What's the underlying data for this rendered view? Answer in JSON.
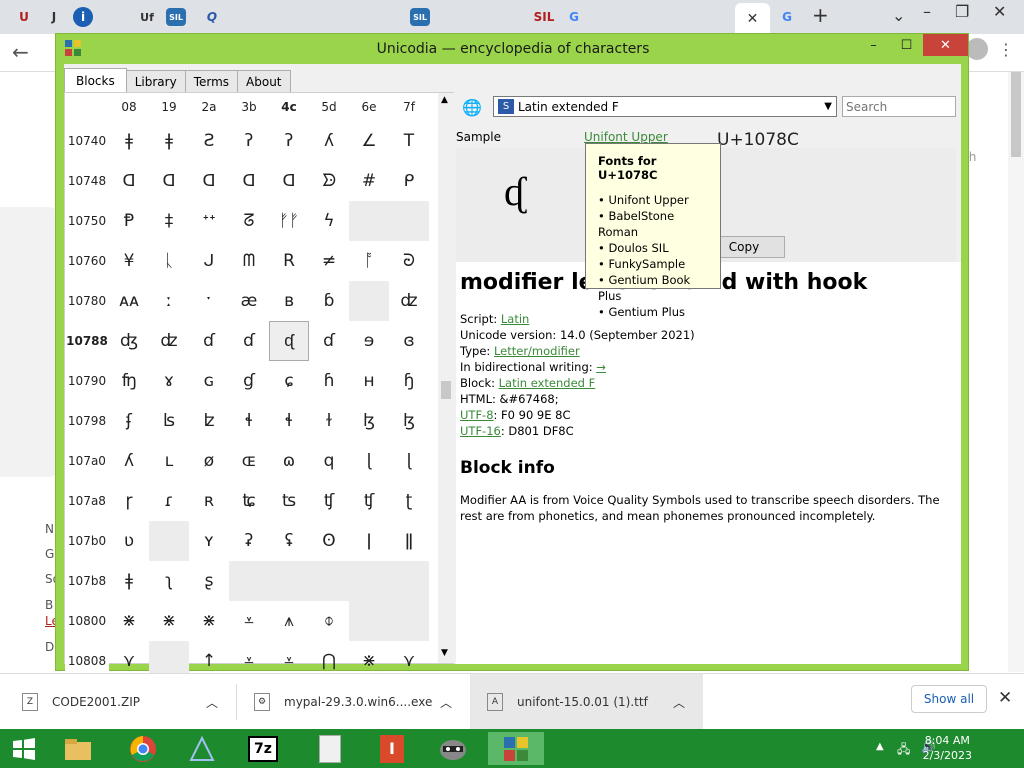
{
  "browser": {
    "tab_icons": [
      "U",
      "J",
      "i",
      "",
      "Uf",
      "SIL",
      "Q",
      "",
      "",
      "",
      "SIL",
      "",
      "",
      "SIL",
      "",
      "",
      "",
      "",
      "G",
      "",
      "",
      "",
      "",
      "",
      "G"
    ],
    "new_tab": "+",
    "tab_close": "✕",
    "bg_texts": [
      "N",
      "G",
      "So",
      "B",
      "Le",
      "D",
      "th"
    ]
  },
  "app": {
    "title": "Unicodia — encyclopedia of characters",
    "tabs": [
      "Blocks",
      "Library",
      "Terms",
      "About"
    ],
    "grid": {
      "col_headers": [
        "08",
        "19",
        "2a",
        "3b",
        "4c",
        "5d",
        "6e",
        "7f"
      ],
      "rows": [
        {
          "label": "10740",
          "cells": [
            "ǂ",
            "ǂ",
            "Ƨ",
            "ʔ",
            "ʔ",
            "ʎ",
            "∠",
            "T"
          ]
        },
        {
          "label": "10748",
          "cells": [
            "ᗡ",
            "ᗡ",
            "ᗡ",
            "ᗡ",
            "ᗡ",
            "ᗦ",
            "#",
            "ᑭ"
          ]
        },
        {
          "label": "10750",
          "cells": [
            "Ᵽ",
            "‡",
            "ᐩᐩ",
            "ᘔ",
            "ᚠᚠ",
            "ϟ",
            "",
            ""
          ]
        },
        {
          "label": "10760",
          "cells": [
            "¥",
            "ᚳ",
            "ᒍ",
            "ᗰ",
            "R",
            "≠",
            "ᚩ",
            "ᘒ"
          ]
        },
        {
          "label": "10780",
          "cells": [
            "ᴀᴀ",
            "ː",
            "ˑ",
            "æ",
            "ʙ",
            "ɓ",
            "",
            "ʣ"
          ]
        },
        {
          "label": "10788",
          "cells": [
            "ʤ",
            "ʣ",
            "ɗ",
            "ɗ",
            "ᶑ",
            "ɗ",
            "ɘ",
            "ɞ"
          ]
        },
        {
          "label": "10790",
          "cells": [
            "ʩ",
            "ɤ",
            "ɢ",
            "ɠ",
            "ɕ",
            "ɦ",
            "ʜ",
            "ɧ"
          ]
        },
        {
          "label": "10798",
          "cells": [
            "ʄ",
            "ʪ",
            "ʫ",
            "ɬ",
            "ɬ",
            "ɫ",
            "ɮ",
            "ɮ"
          ]
        },
        {
          "label": "107a0",
          "cells": [
            "ʎ",
            "ʟ",
            "ø",
            "ɶ",
            "ɷ",
            "q",
            "ɭ",
            "ɭ"
          ]
        },
        {
          "label": "107a8",
          "cells": [
            "ɼ",
            "ɾ",
            "ʀ",
            "ʨ",
            "ʦ",
            "ʧ",
            "ʧ",
            "ʈ"
          ]
        },
        {
          "label": "107b0",
          "cells": [
            "ʋ",
            "",
            "ʏ",
            "ʡ",
            "ʢ",
            "ʘ",
            "ǀ",
            "ǁ"
          ]
        },
        {
          "label": "107b8",
          "cells": [
            "ǂ",
            "ʅ",
            "ʂ",
            "",
            "",
            "",
            "",
            ""
          ]
        },
        {
          "label": "10800",
          "cells": [
            "⋇",
            "⋇",
            "⋇",
            "⩡",
            "⩚",
            "⌽",
            "",
            ""
          ]
        },
        {
          "label": "10808",
          "cells": [
            "⋎",
            "",
            "↑",
            "⩡",
            "⩡",
            "⋂",
            "⋇",
            "⋎"
          ]
        }
      ]
    },
    "block_select": "Latin extended F",
    "search_placeholder": "Search",
    "sample_label": "Sample",
    "font_link": "Unifont Upper",
    "codepoint": "U+1078C",
    "glyph": "ᶑ",
    "copy": "Copy",
    "char_name": "modifier letter small d with hook",
    "props": {
      "script_label": "Script: ",
      "script": "Latin",
      "version": "Unicode version: 14.0 (September 2021)",
      "type_label": "Type: ",
      "type": "Letter/modifier",
      "bidi_label": "In bidirectional writing: ",
      "bidi": "→",
      "block_label": "Block: ",
      "block": "Latin extended F",
      "html": "HTML: &#67468;",
      "utf8_label": "UTF-8",
      "utf8": ": F0 90 9E 8C",
      "utf16_label": "UTF-16",
      "utf16": ": D801 DF8C"
    },
    "block_info_heading": "Block info",
    "block_info": "Modifier AA is from Voice Quality Symbols used to transcribe speech disorders. The rest are from phonetics, and mean phonemes pronounced incompletely.",
    "tooltip": {
      "title": "Fonts for U+1078C",
      "items": [
        "• Unifont Upper",
        "• BabelStone Roman",
        "• Doulos SIL",
        "• FunkySample",
        "• Gentium Book Plus",
        "• Gentium Plus"
      ]
    }
  },
  "downloads": {
    "items": [
      "CODE2001.ZIP",
      "mypal-29.3.0.win6....exe",
      "unifont-15.0.01 (1).ttf"
    ],
    "show_all": "Show all"
  },
  "taskbar": {
    "time": "8:04 AM",
    "date": "2/3/2023",
    "icons": [
      "windows-start",
      "file-explorer",
      "chrome",
      "setup",
      "7zip",
      "document",
      "office",
      "raccoon",
      "unicodia"
    ]
  }
}
